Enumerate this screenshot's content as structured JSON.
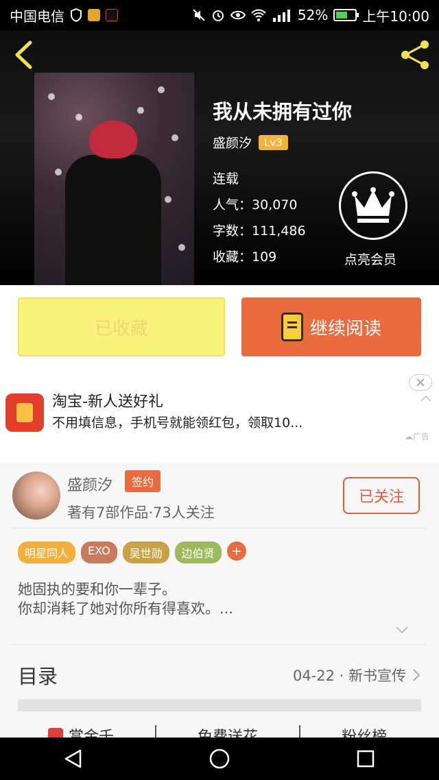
{
  "status_bar": {
    "carrier": "中国电信",
    "battery": "52%",
    "battery_level": 0.52,
    "time": "上午10:00"
  },
  "book": {
    "title": "我从未拥有过你",
    "author": "盛颜汐",
    "level": "Lv3",
    "status": "连载",
    "popularity": "人气：30,070",
    "words": "字数：111,486",
    "favorites": "收藏：109"
  },
  "vip": {
    "label": "点亮会员"
  },
  "actions": {
    "collected_label": "已收藏",
    "read_label": "继续阅读"
  },
  "ad": {
    "title": "淘宝-新人送好礼",
    "description": "不用填信息，手机号就能领红包，领取10...",
    "tag": "广告"
  },
  "author": {
    "name": "盛颜汐",
    "badge": "签约",
    "stats": "著有7部作品·73人关注",
    "follow_label": "已关注"
  },
  "tags": [
    {
      "label": "明星同人",
      "color": "#f3ae3c"
    },
    {
      "label": "EXO",
      "color": "#c87a5c"
    },
    {
      "label": "吴世勋",
      "color": "#c9a246"
    },
    {
      "label": "边伯贤",
      "color": "#9cba5b"
    }
  ],
  "tag_add": "+",
  "intro": {
    "line1": "她固执的要和你一辈子。",
    "line2": "你却消耗了她对你所有得喜欢。..."
  },
  "toc": {
    "title": "目录",
    "latest": "04-22 · 新书宣传"
  },
  "bottom_links": [
    "赏金千",
    "免费送花",
    "粉丝榜"
  ],
  "colors": {
    "accent": "#ea6b3f",
    "collected_bg": "#fbf27b",
    "level_badge": "#f3b33a"
  }
}
